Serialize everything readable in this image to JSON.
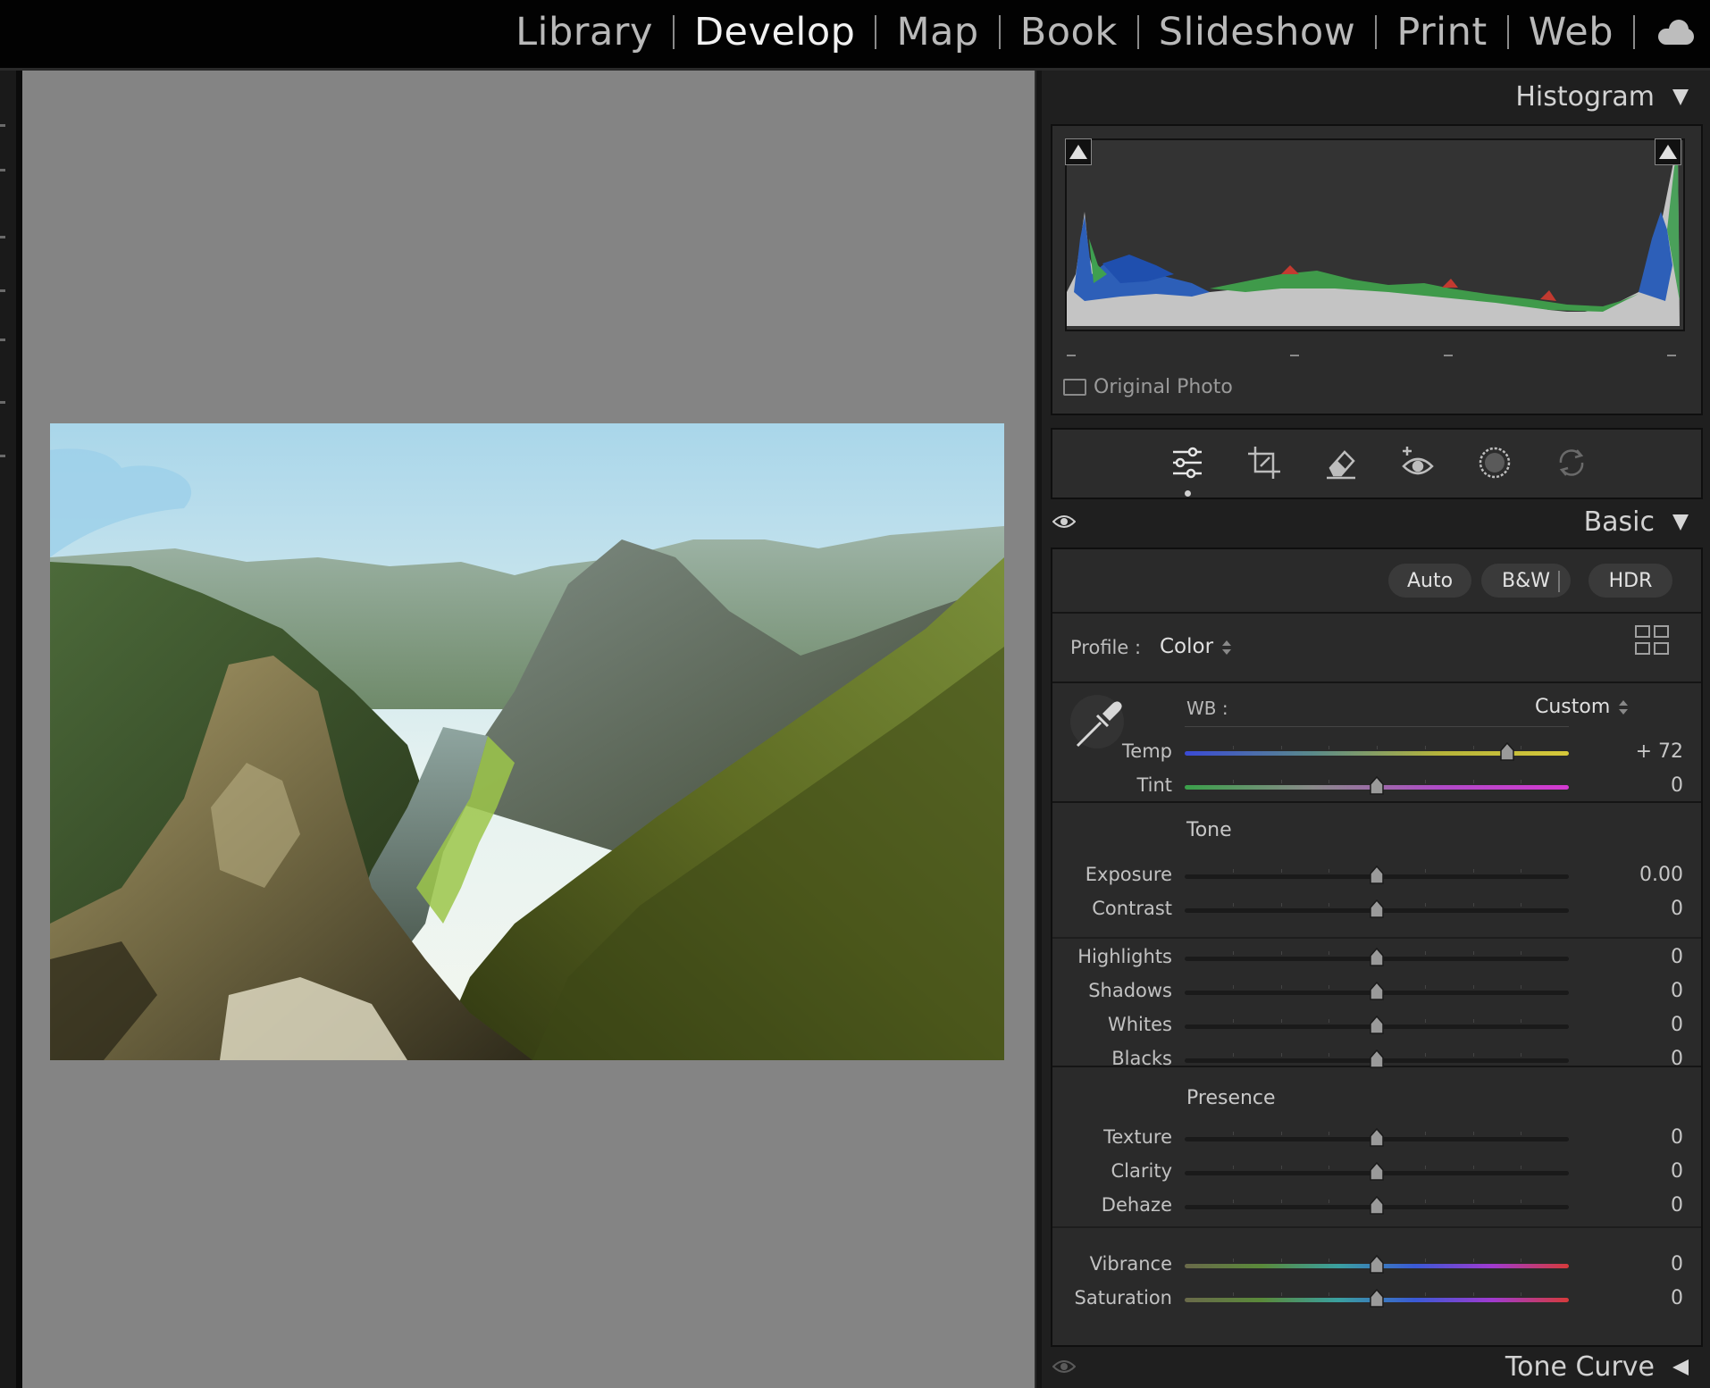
{
  "modules": [
    "Library",
    "Develop",
    "Map",
    "Book",
    "Slideshow",
    "Print",
    "Web"
  ],
  "active_module": "Develop",
  "histogram": {
    "title": "Histogram",
    "original_photo_label": "Original Photo"
  },
  "tools": [
    "edit-sliders-icon",
    "crop-icon",
    "healing-eraser-icon",
    "red-eye-icon",
    "masking-icon",
    "reset-icon"
  ],
  "basic": {
    "title": "Basic",
    "buttons": {
      "auto": "Auto",
      "bw": "B&W",
      "hdr": "HDR"
    },
    "profile_label": "Profile :",
    "profile_value": "Color",
    "wb_label": "WB :",
    "wb_value": "Custom",
    "tone_label": "Tone",
    "presence_label": "Presence",
    "sliders": {
      "temp": {
        "label": "Temp",
        "value": "+ 72",
        "level": 0.84
      },
      "tint": {
        "label": "Tint",
        "value": "0",
        "level": 0.5
      },
      "exposure": {
        "label": "Exposure",
        "value": "0.00",
        "level": 0.5
      },
      "contrast": {
        "label": "Contrast",
        "value": "0",
        "level": 0.5
      },
      "highlights": {
        "label": "Highlights",
        "value": "0",
        "level": 0.5
      },
      "shadows": {
        "label": "Shadows",
        "value": "0",
        "level": 0.5
      },
      "whites": {
        "label": "Whites",
        "value": "0",
        "level": 0.5
      },
      "blacks": {
        "label": "Blacks",
        "value": "0",
        "level": 0.5
      },
      "texture": {
        "label": "Texture",
        "value": "0",
        "level": 0.5
      },
      "clarity": {
        "label": "Clarity",
        "value": "0",
        "level": 0.5
      },
      "dehaze": {
        "label": "Dehaze",
        "value": "0",
        "level": 0.5
      },
      "vibrance": {
        "label": "Vibrance",
        "value": "0",
        "level": 0.5
      },
      "saturation": {
        "label": "Saturation",
        "value": "0",
        "level": 0.5
      }
    }
  },
  "tone_curve": {
    "title": "Tone Curve"
  },
  "colors": {
    "panel_bg": "#2a2a2a",
    "canvas_bg": "#848484",
    "active_text": "#f2f2f2",
    "inactive_text": "#b9b9b9"
  }
}
